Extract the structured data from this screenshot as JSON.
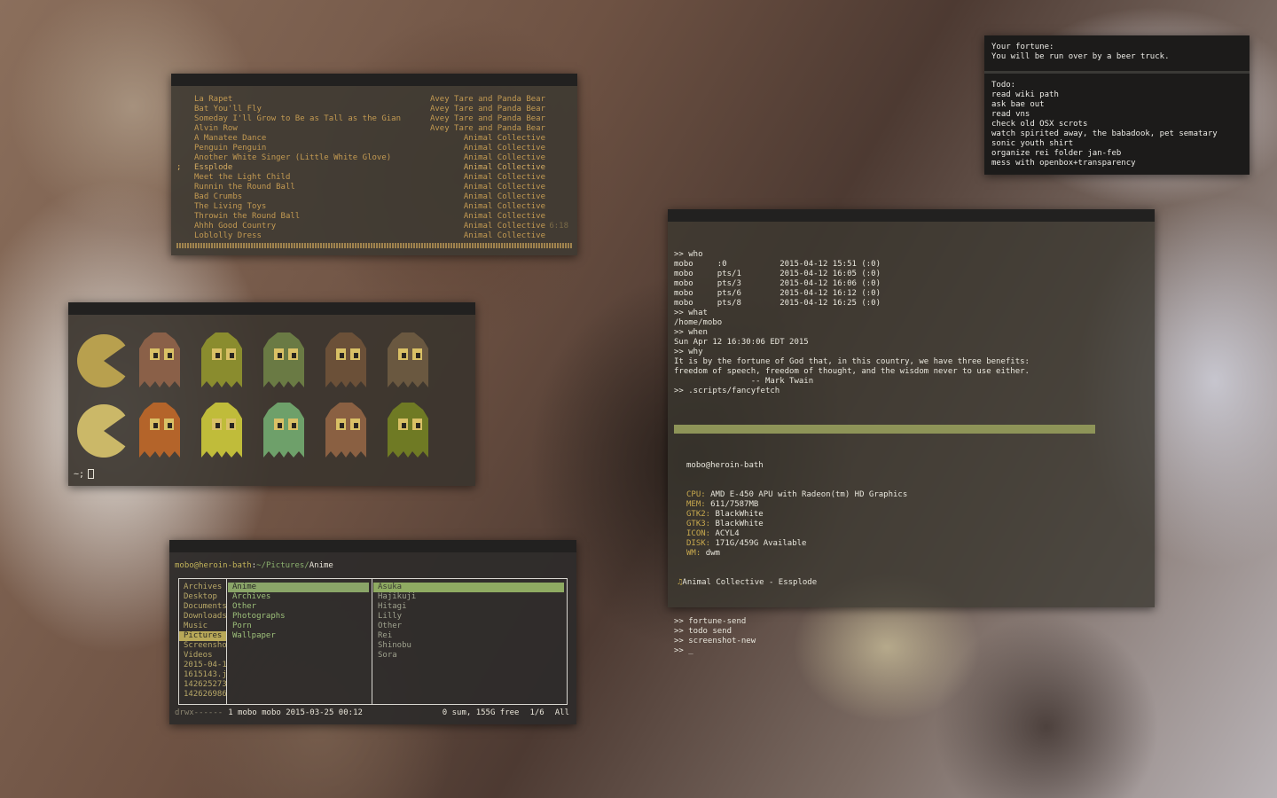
{
  "music": {
    "tracks": [
      {
        "marker": "",
        "title": "La Rapet",
        "artist": "Avey Tare and Panda Bear",
        "duration": ""
      },
      {
        "marker": "",
        "title": "Bat You'll Fly",
        "artist": "Avey Tare and Panda Bear",
        "duration": ""
      },
      {
        "marker": "",
        "title": "Someday I'll Grow to Be as Tall as the Gian",
        "artist": "Avey Tare and Panda Bear",
        "duration": ""
      },
      {
        "marker": "",
        "title": "Alvin Row",
        "artist": "Avey Tare and Panda Bear",
        "duration": ""
      },
      {
        "marker": "",
        "title": "A Manatee Dance",
        "artist": "Animal Collective",
        "duration": ""
      },
      {
        "marker": "",
        "title": "Penguin Penguin",
        "artist": "Animal Collective",
        "duration": ""
      },
      {
        "marker": "",
        "title": "Another White Singer (Little White Glove)",
        "artist": "Animal Collective",
        "duration": ""
      },
      {
        "marker": ";",
        "title": "Essplode",
        "artist": "Animal Collective",
        "duration": ""
      },
      {
        "marker": "",
        "title": "Meet the Light Child",
        "artist": "Animal Collective",
        "duration": ""
      },
      {
        "marker": "",
        "title": "Runnin the Round Ball",
        "artist": "Animal Collective",
        "duration": ""
      },
      {
        "marker": "",
        "title": "Bad Crumbs",
        "artist": "Animal Collective",
        "duration": ""
      },
      {
        "marker": "",
        "title": "The Living Toys",
        "artist": "Animal Collective",
        "duration": ""
      },
      {
        "marker": "",
        "title": "Throwin the Round Ball",
        "artist": "Animal Collective",
        "duration": ""
      },
      {
        "marker": "",
        "title": "Ahhh Good Country",
        "artist": "Animal Collective",
        "duration": "6:18"
      },
      {
        "marker": "",
        "title": "Loblolly Dress",
        "artist": "Animal Collective",
        "duration": ""
      }
    ],
    "progress": 1.0
  },
  "pacman": {
    "prompt": "~;",
    "colors": {
      "pac_top": "#b8a04e",
      "pac_bottom": "#cbb868",
      "ghosts_top": [
        "#8a6048",
        "#8a8c2e",
        "#6a7a44",
        "#6b5038",
        "#6a5840"
      ],
      "ghosts_bottom": [
        "#b4642a",
        "#c0bc3a",
        "#6ea06a",
        "#8a6042",
        "#6f7a24"
      ],
      "eye": "#d9c065"
    }
  },
  "files": {
    "path_user": "mobo@heroin-bath",
    "path_sep": ":",
    "path_dir": "~/Pictures/",
    "path_current": "Anime",
    "col1": [
      "Archives",
      "Desktop",
      "Documents",
      "Downloads",
      "Music",
      "Pictures",
      "Screensho",
      "Videos",
      "2015-04-1",
      "1615143.j",
      "142625273",
      "142626986"
    ],
    "col1_selected": 5,
    "col2": [
      "Anime",
      "Archives",
      "Other",
      "Photographs",
      "Porn",
      "Wallpaper"
    ],
    "col2_selected": 0,
    "col3": [
      "Asuka",
      "Hajikuji",
      "Hitagi",
      "Lilly",
      "Other",
      "Rei",
      "Shinobu",
      "Sora"
    ],
    "col3_selected": 0,
    "status_perm": "drwx------",
    "status_info": "1 mobo mobo 2015-03-25 00:12",
    "status_free": "0 sum, 155G free",
    "status_pos": "1/6",
    "status_all": "All"
  },
  "terminal": {
    "lines_top": [
      ">> who",
      "mobo     :0           2015-04-12 15:51 (:0)",
      "mobo     pts/1        2015-04-12 16:05 (:0)",
      "mobo     pts/3        2015-04-12 16:06 (:0)",
      "mobo     pts/6        2015-04-12 16:12 (:0)",
      "mobo     pts/8        2015-04-12 16:25 (:0)",
      ">> what",
      "/home/mobo",
      ">> when",
      "Sun Apr 12 16:30:06 EDT 2015",
      ">> why",
      "It is by the fortune of God that, in this country, we have three benefits:",
      "freedom of speech, freedom of thought, and the wisdom never to use either.",
      "                -- Mark Twain",
      ">> .scripts/fancyfetch"
    ],
    "fetch_host": "mobo@heroin-bath",
    "fetch": [
      {
        "key": "CPU:",
        "value": "AMD E-450 APU with Radeon(tm) HD Graphics"
      },
      {
        "key": "MEM:",
        "value": "611/7587MB"
      },
      {
        "key": "GTK2:",
        "value": "BlackWhite"
      },
      {
        "key": "GTK3:",
        "value": "BlackWhite"
      },
      {
        "key": "ICON:",
        "value": "ACYL4"
      },
      {
        "key": "DISK:",
        "value": "171G/459G Available"
      },
      {
        "key": "WM:",
        "value": "dwm"
      }
    ],
    "now_playing_icon": "♫",
    "now_playing": "Animal Collective - Essplode",
    "lines_bottom": [
      "",
      ">> fortune-send",
      ">> todo send",
      ">> screenshot-new",
      ">> _"
    ]
  },
  "todo": {
    "fortune_label": "Your fortune:",
    "fortune": "You will be run over by a beer truck.",
    "todo_label": "Todo:",
    "items": [
      "read wiki path",
      "ask bae out",
      "read vns",
      "check old OSX scrots",
      "watch spirited away, the babadook, pet sematary",
      "sonic youth shirt",
      "organize rei folder jan-feb",
      "mess with openbox+transparency"
    ]
  }
}
